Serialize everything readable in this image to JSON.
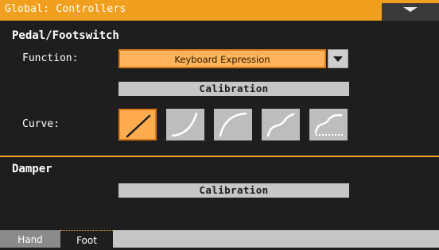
{
  "window": {
    "title": "Global: Controllers"
  },
  "pedal_section": {
    "title": "Pedal/Footswitch",
    "function_label": "Function:",
    "function_value": "Keyboard Expression",
    "calibration_label": "Calibration",
    "curve_label": "Curve:",
    "curves": [
      {
        "icon": "curve-linear-icon",
        "selected": true
      },
      {
        "icon": "curve-exponential-icon",
        "selected": false
      },
      {
        "icon": "curve-logarithmic-icon",
        "selected": false
      },
      {
        "icon": "curve-s-icon",
        "selected": false
      },
      {
        "icon": "curve-s-dotted-icon",
        "selected": false
      }
    ]
  },
  "damper_section": {
    "title": "Damper",
    "calibration_label": "Calibration"
  },
  "tabs": [
    {
      "label": "Hand",
      "active": false
    },
    {
      "label": "Foot",
      "active": true
    }
  ],
  "colors": {
    "accent": "#f0a01e",
    "background": "#1e1e1e",
    "selected_field": "#ffb35a",
    "button": "#c6c6c6"
  }
}
